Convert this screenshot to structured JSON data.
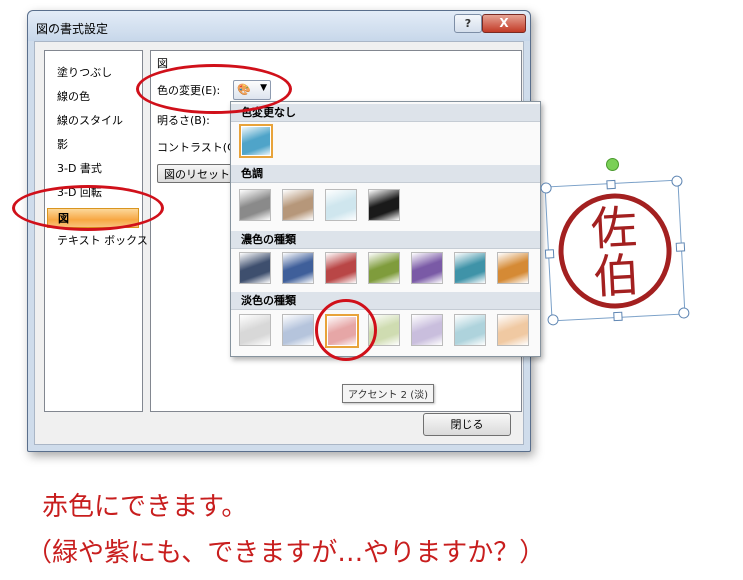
{
  "dialog": {
    "title": "図の書式設定",
    "help_label": "?",
    "close_label": "X",
    "nav_items": [
      {
        "label": "塗りつぶし"
      },
      {
        "label": "線の色"
      },
      {
        "label": "線のスタイル"
      },
      {
        "label": "影"
      },
      {
        "label": "3-D 書式"
      },
      {
        "label": "3-D 回転"
      },
      {
        "label": "図"
      },
      {
        "label": "テキスト ボックス"
      }
    ],
    "selected_nav": "図",
    "panel": {
      "section_title": "図",
      "color_change_label": "色の変更(E):",
      "brightness_label": "明るさ(B):",
      "contrast_label": "コントラスト(C):",
      "reset_button_label": "図のリセット(E"
    },
    "footer_close_label": "閉じる"
  },
  "gallery": {
    "sections": [
      {
        "label": "色変更なし",
        "colors": [
          "#4fa4c9"
        ]
      },
      {
        "label": "色調",
        "colors": [
          "#8a8a8a",
          "#b6977a",
          "#cfe6ee",
          "#1a1a1a"
        ]
      },
      {
        "label": "濃色の種類",
        "colors": [
          "#3e4f6e",
          "#3f5f9a",
          "#b94646",
          "#7f9c3c",
          "#7a5aa6",
          "#3f93a8",
          "#d58a35"
        ]
      },
      {
        "label": "淡色の種類",
        "colors": [
          "#d8d8d8",
          "#b5c4dc",
          "#e6a6a6",
          "#cfdcb1",
          "#c9bedd",
          "#aed3dc",
          "#f0c9a2"
        ]
      }
    ],
    "tooltip": "アクセント 2 (淡)"
  },
  "seal": {
    "char_top": "佐",
    "char_bottom": "伯",
    "color": "#a32020"
  },
  "annotations": {
    "color": "#d0101a"
  },
  "caption": {
    "line1": "赤色にできます。",
    "line2": "（緑や紫にも、できますが…やりますか？）",
    "color": "#c81e1e"
  }
}
